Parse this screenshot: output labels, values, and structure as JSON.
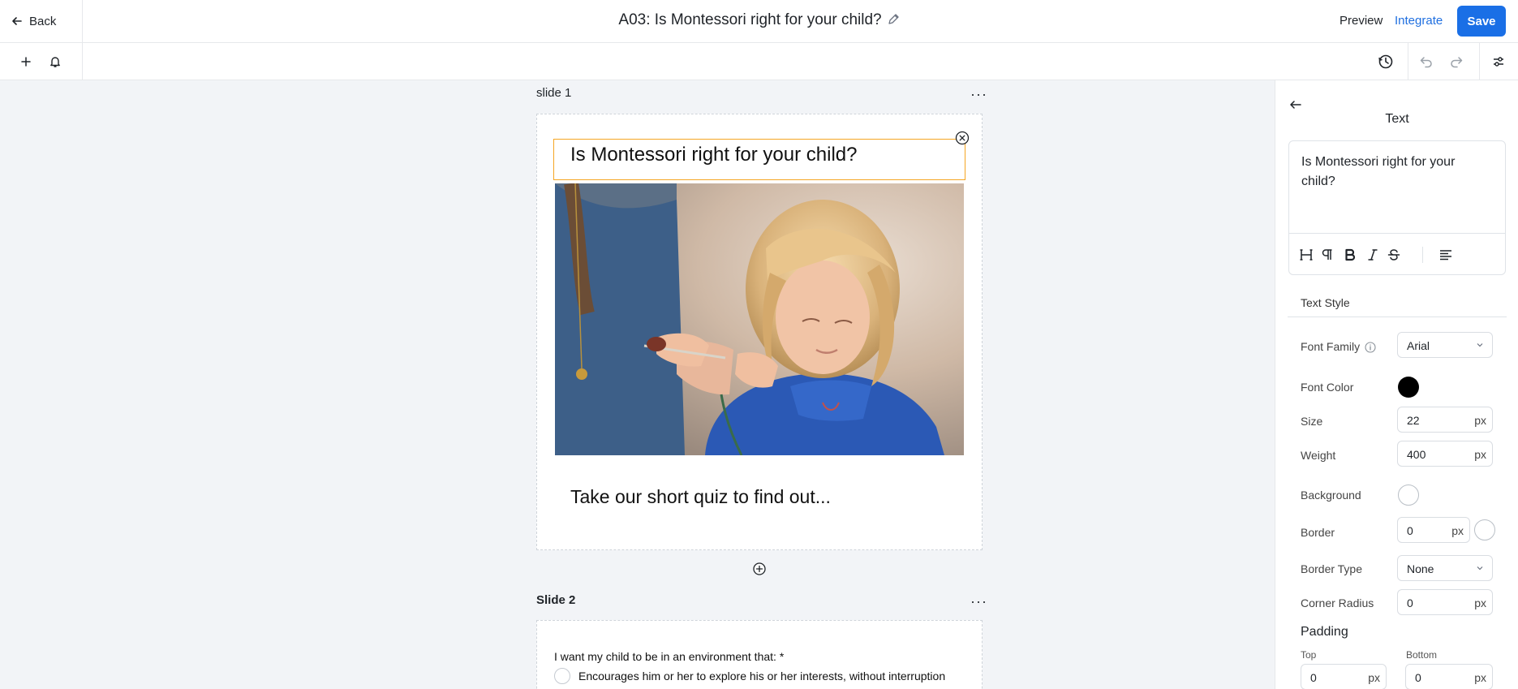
{
  "header": {
    "back_label": "Back",
    "title": "A03: Is Montessori right for your child?",
    "preview_label": "Preview",
    "integrate_label": "Integrate",
    "save_label": "Save"
  },
  "toolbar": {
    "left_icons": [
      "plus-icon",
      "bell-icon"
    ],
    "right_icons": [
      "history-icon",
      "undo-icon",
      "redo-icon",
      "settings-sliders-icon"
    ]
  },
  "canvas": {
    "slides": [
      {
        "label": "slide 1",
        "heading": "Is Montessori right for your child?",
        "subtitle": "Take our short quiz to find out..."
      },
      {
        "label": "Slide 2",
        "question": "I want my child to be in an environment that: *",
        "options": [
          "Encourages him or her to explore his or her interests, without interruption"
        ]
      }
    ]
  },
  "panel": {
    "title": "Text",
    "editor_text": "Is Montessori right for your child?",
    "format_tools": [
      "heading-icon",
      "paragraph-icon",
      "bold-icon",
      "italic-icon",
      "strikethrough-icon",
      "align-left-icon"
    ],
    "text_style_heading": "Text Style",
    "font_family_label": "Font Family",
    "font_family_value": "Arial",
    "font_color_label": "Font Color",
    "font_color_value": "#000000",
    "size_label": "Size",
    "size_value": "22",
    "weight_label": "Weight",
    "weight_value": "400",
    "background_label": "Background",
    "background_value": "#ffffff",
    "border_label": "Border",
    "border_value": "0",
    "border_color_value": "#ffffff",
    "border_type_label": "Border Type",
    "border_type_value": "None",
    "corner_radius_label": "Corner Radius",
    "corner_radius_value": "0",
    "padding_heading": "Padding",
    "padding_top_label": "Top",
    "padding_top_value": "0",
    "padding_bottom_label": "Bottom",
    "padding_bottom_value": "0",
    "unit": "px"
  },
  "colors": {
    "accent": "#1a6fe6",
    "selection": "#f5a623",
    "canvas_bg": "#f2f4f7"
  }
}
